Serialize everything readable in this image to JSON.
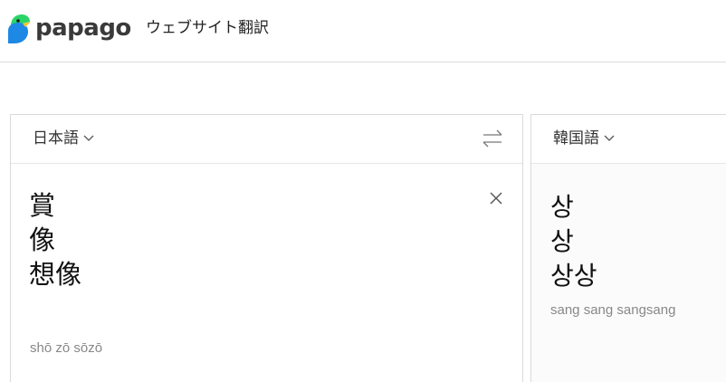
{
  "header": {
    "logo_text": "papago",
    "page_title": "ウェブサイト翻訳"
  },
  "source": {
    "language": "日本語",
    "lines": [
      "賞",
      "像",
      "想像"
    ],
    "pronunciation": "shō zō sōzō"
  },
  "target": {
    "language": "韓国語",
    "lines": [
      "상",
      "상",
      "상상"
    ],
    "pronunciation": "sang sang sangsang"
  },
  "icons": {
    "logo": "papago-parrot-icon",
    "swap": "swap-arrows-icon",
    "clear": "close-icon",
    "dropdown": "chevron-down-icon"
  },
  "colors": {
    "logo_green": "#2bd468",
    "logo_blue": "#1e88e5"
  }
}
